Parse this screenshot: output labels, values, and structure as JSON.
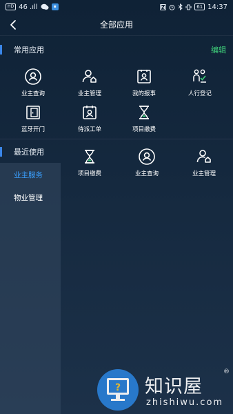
{
  "status_bar": {
    "left_chip_hd": "HD",
    "left_signal": "46 .ıll",
    "right_battery": "61",
    "right_time": "14:37"
  },
  "header": {
    "title": "全部应用"
  },
  "common_apps": {
    "title": "常用应用",
    "edit_label": "编辑",
    "items": [
      {
        "label": "业主查询",
        "icon": "user-search-icon"
      },
      {
        "label": "业主管理",
        "icon": "user-house-icon"
      },
      {
        "label": "我的报事",
        "icon": "report-card-icon"
      },
      {
        "label": "人行登记",
        "icon": "people-register-icon"
      },
      {
        "label": "蓝牙开门",
        "icon": "door-icon"
      },
      {
        "label": "待派工单",
        "icon": "work-order-icon"
      },
      {
        "label": "项目缴费",
        "icon": "hourglass-icon"
      }
    ]
  },
  "recent": {
    "title": "最近使用",
    "items": [
      {
        "label": "项目缴费",
        "icon": "hourglass-icon"
      },
      {
        "label": "业主查询",
        "icon": "user-search-icon"
      },
      {
        "label": "业主管理",
        "icon": "user-house-icon"
      }
    ]
  },
  "sidebar": {
    "items": [
      {
        "label": "业主服务",
        "active": true
      },
      {
        "label": "物业管理",
        "active": false
      }
    ]
  },
  "watermark": {
    "main": "知识屋",
    "reg": "®",
    "sub": "zhishiwu.com"
  },
  "colors": {
    "accent_blue": "#3a86e8",
    "edit_green": "#3fcf7a",
    "active_blue": "#3aa0ff"
  }
}
